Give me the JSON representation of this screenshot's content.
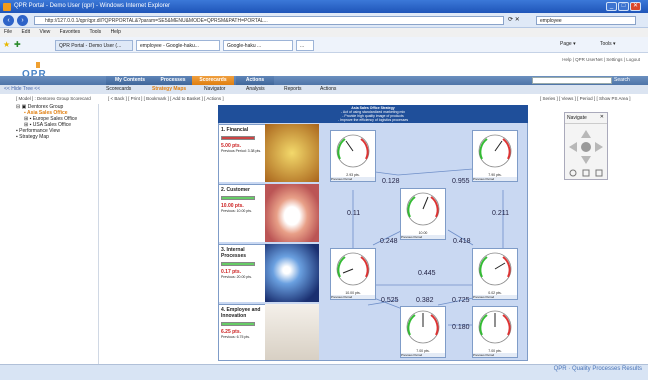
{
  "window": {
    "title": "QPR Portal - Demo User (qpr) - Windows Internet Explorer",
    "minimize": "_",
    "maximize": "□",
    "close": "✕"
  },
  "browser": {
    "url": "http://127.0.0.1/qpr/qpr.dll?QPRPORTAL&?param=SE5&MENU&MODE=QPRSM&PATH=PORTAL...",
    "search_value": "employee",
    "menu": [
      "File",
      "Edit",
      "View",
      "Favorites",
      "Tools",
      "Help"
    ],
    "tabs": [
      "QPR Portal - Demo User (...",
      "employee - Google-haku...",
      "Google-haku ...",
      "..."
    ],
    "toolbar_right": [
      "Page ▾",
      "Tools ▾"
    ]
  },
  "app": {
    "logo": "QPR",
    "toplinks": "Help | QPR UserNet | Settings | Logout",
    "tabs": [
      "My Contents",
      "Processes",
      "Scorecards",
      "Actions"
    ],
    "active_tab": "Scorecards",
    "search_button": "Search",
    "subnav": [
      "<< Hide Tree <<",
      "Scorecards",
      "Strategy Maps",
      "Navigator",
      "Analysis",
      "Reports",
      "Actions"
    ],
    "breadcrumb": "[ Model ] : Dentorex Group Scorecard",
    "crumb_actions": "[ < Back ] [ Print ] [ Bookmark ] [ Add to Basket ] [ Actions ]",
    "view_actions": "[ Series ] [ Views ] [ Period ] [ Show PS Area ]"
  },
  "tree": [
    {
      "label": "Dentorex Group",
      "level": 0
    },
    {
      "label": "Asia Sales Office",
      "level": 1,
      "selected": true
    },
    {
      "label": "Europe Sales Office",
      "level": 1
    },
    {
      "label": "USA Sales Office",
      "level": 1
    },
    {
      "label": "Performance View",
      "level": 0
    },
    {
      "label": "Strategy Map",
      "level": 0
    }
  ],
  "map": {
    "header_lines": [
      "Asia Sales Office Strategy",
      "- Act of using standardized marketing mix",
      "- Provide high quality image of products",
      "- Improve the efficiency of logistics processes"
    ],
    "rows": [
      {
        "title": "1. Financial",
        "value": "5.00 pts.",
        "previous": "Previous Period:",
        "prev_val": "3.38 pts."
      },
      {
        "title": "2. Customer",
        "value": "10.00 pts.",
        "previous": "Previous:",
        "prev_val": "10.00 pts."
      },
      {
        "title": "3. Internal Processes",
        "value": "0.17 pts.",
        "previous": "Previous:",
        "prev_val": "20.00 pts."
      },
      {
        "title": "4. Employee and Innovation",
        "value": "6.25 pts.",
        "previous": "Previous:",
        "prev_val": "6.75 pts."
      }
    ],
    "gauges": [
      {
        "value": "2.93 pts.",
        "foot": "Previous Period"
      },
      {
        "value": "7.90 pts.",
        "foot": "Previous Period"
      },
      {
        "value": "10.00",
        "foot": "Previous Period"
      },
      {
        "value": "10.00 pts.",
        "foot": "Previous Period"
      },
      {
        "value": "0.02 pts.",
        "foot": "Previous Period"
      },
      {
        "value": "7.00 pts.",
        "foot": "Previous Period"
      },
      {
        "value": "7.00 pts.",
        "foot": "Previous Period"
      }
    ],
    "links": [
      "0.128",
      "0.955",
      "0.11",
      "0.211",
      "0.248",
      "0.418",
      "0.445",
      "0.525",
      "0.382",
      "0.725",
      "0.180"
    ]
  },
  "navigate": {
    "title": "Navigate",
    "close": "✕"
  },
  "footer": "QPR · Quality Processes Results",
  "colors": {
    "accent": "#e8891a",
    "brand": "#3a6aa8",
    "map_bg": "#c9d8f2"
  }
}
